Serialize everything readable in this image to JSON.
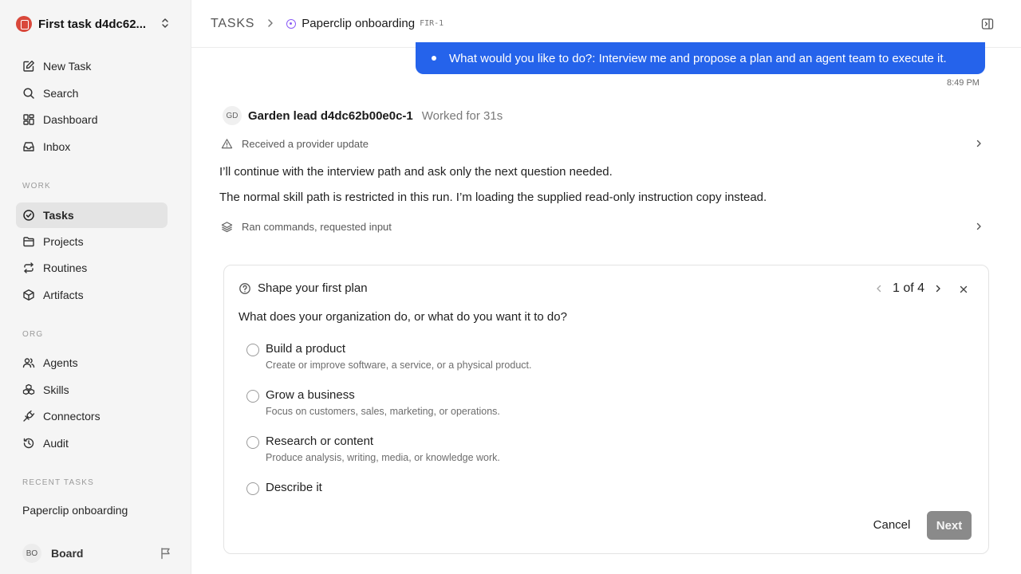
{
  "sidebar": {
    "workspace_name": "First task d4dc62...",
    "primary": [
      {
        "label": "New Task"
      },
      {
        "label": "Search"
      },
      {
        "label": "Dashboard"
      },
      {
        "label": "Inbox"
      }
    ],
    "work_label": "WORK",
    "work": [
      {
        "label": "Tasks",
        "active": true
      },
      {
        "label": "Projects"
      },
      {
        "label": "Routines"
      },
      {
        "label": "Artifacts"
      }
    ],
    "org_label": "ORG",
    "org": [
      {
        "label": "Agents"
      },
      {
        "label": "Skills"
      },
      {
        "label": "Connectors"
      },
      {
        "label": "Audit"
      }
    ],
    "recent_label": "RECENT TASKS",
    "recent": [
      {
        "label": "Paperclip onboarding"
      }
    ],
    "footer": {
      "initials": "BO",
      "name": "Board"
    }
  },
  "header": {
    "root": "TASKS",
    "title": "Paperclip onboarding",
    "task_id": "FIR-1"
  },
  "conversation": {
    "user_bubble": "What would you like to do?: Interview me and propose a plan and an agent team to execute it.",
    "user_time": "8:49 PM",
    "agent": {
      "initials": "GD",
      "name": "Garden lead d4dc62b00e0c-1",
      "meta": "Worked for 31s"
    },
    "provider_update": "Received a provider update",
    "messages": [
      "I’ll continue with the interview path and ask only the next question needed.",
      "The normal skill path is restricted in this run. I’m loading the supplied read-only instruction copy instead."
    ],
    "commands_summary": "Ran commands, requested input"
  },
  "question_card": {
    "title": "Shape your first plan",
    "pager": "1 of 4",
    "question": "What does your organization do, or what do you want it to do?",
    "options": [
      {
        "label": "Build a product",
        "desc": "Create or improve software, a service, or a physical product."
      },
      {
        "label": "Grow a business",
        "desc": "Focus on customers, sales, marketing, or operations."
      },
      {
        "label": "Research or content",
        "desc": "Produce analysis, writing, media, or knowledge work."
      },
      {
        "label": "Describe it",
        "desc": ""
      }
    ],
    "cancel_label": "Cancel",
    "next_label": "Next"
  },
  "colors": {
    "accent_blue": "#2563eb",
    "status_purple": "#8b5cf6",
    "logo_red": "#d9483b",
    "next_disabled": "#8a8a8a"
  }
}
